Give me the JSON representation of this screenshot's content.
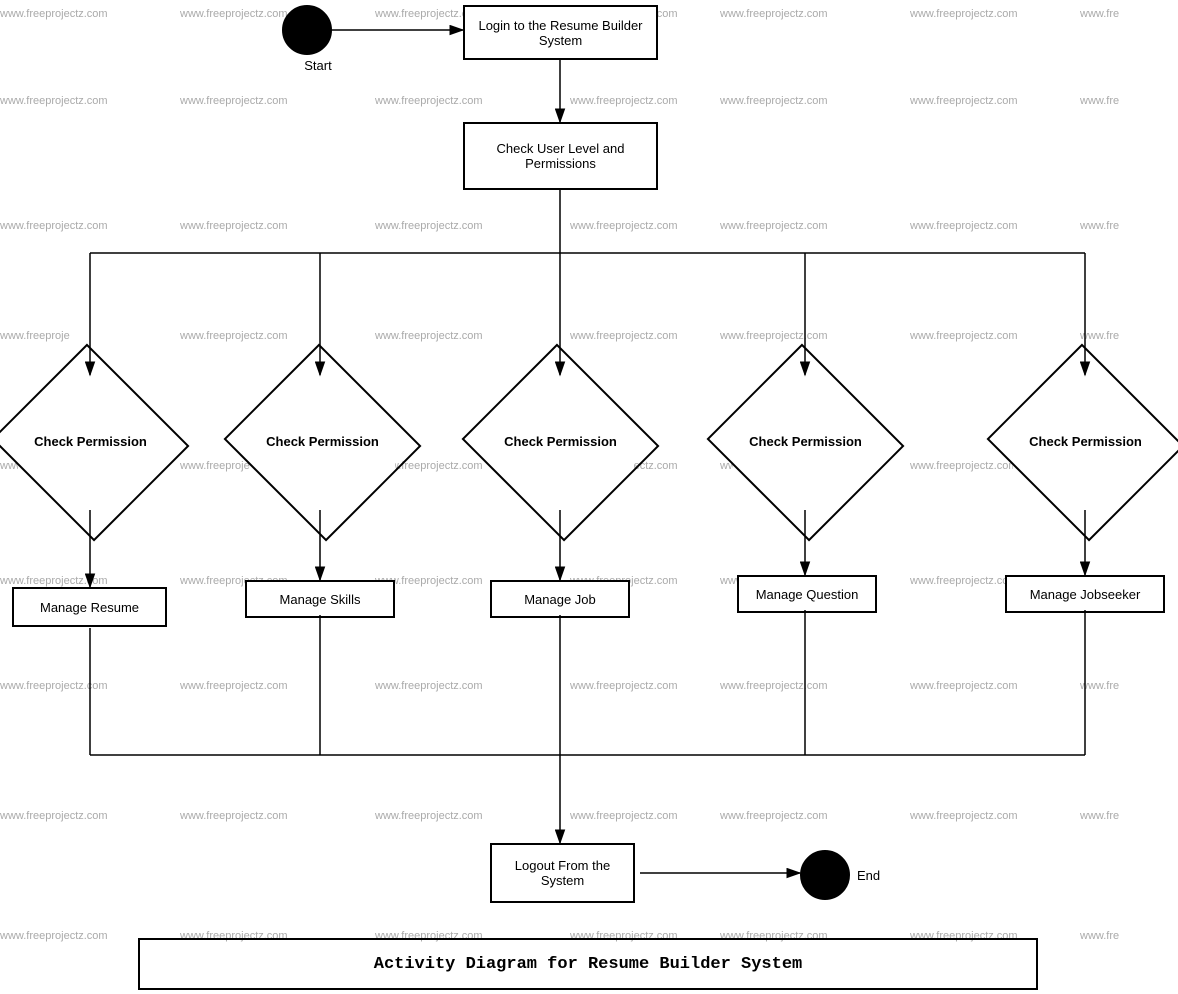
{
  "watermarks": [
    "www.freeprojectz.com"
  ],
  "diagram": {
    "title": "Activity Diagram for Resume Builder System",
    "nodes": {
      "start_circle": {
        "label": "Start"
      },
      "login_box": {
        "label": "Login to the Resume Builder System"
      },
      "check_user_box": {
        "label": "Check User Level and Permissions"
      },
      "diamond1": {
        "label": "Check Permission"
      },
      "diamond2": {
        "label": "Check Permission"
      },
      "diamond3": {
        "label": "Check Permission"
      },
      "diamond4": {
        "label": "Check Permission"
      },
      "diamond5": {
        "label": "Check Permission"
      },
      "manage_resume": {
        "label": "Manage Resume"
      },
      "manage_skills": {
        "label": "Manage Skills"
      },
      "manage_job": {
        "label": "Manage Job"
      },
      "manage_question": {
        "label": "Manage Question"
      },
      "manage_jobseeker": {
        "label": "Manage Jobseeker"
      },
      "logout_box": {
        "label": "Logout From the System"
      },
      "end_circle": {
        "label": "End"
      }
    }
  }
}
